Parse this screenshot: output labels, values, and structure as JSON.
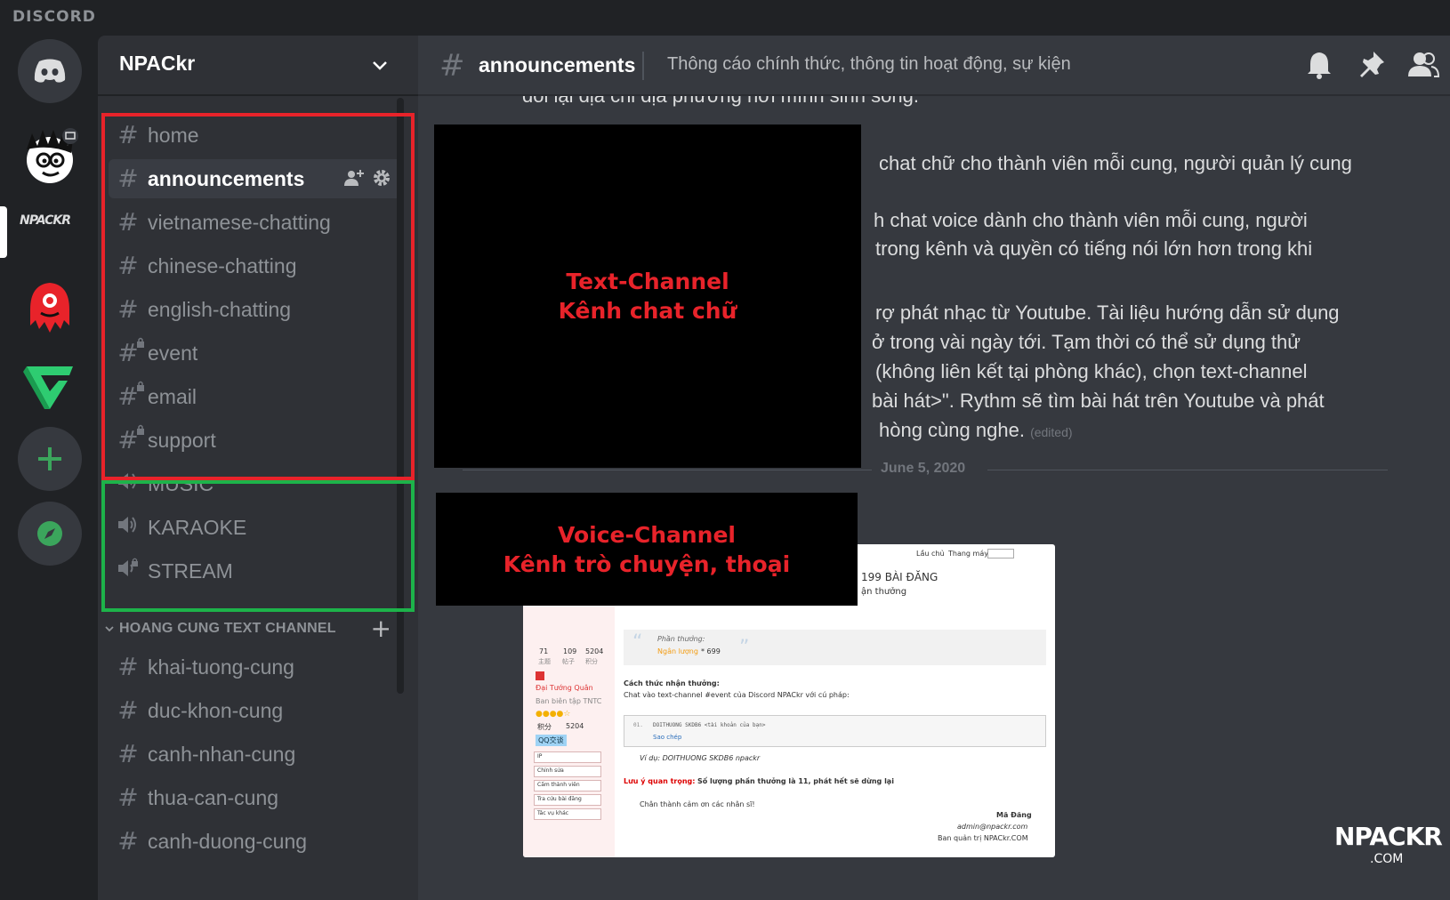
{
  "app": {
    "wordmark": "DISCORD"
  },
  "guilds": {
    "items": [
      {
        "name": "home-icon"
      },
      {
        "name": "npackr-avatar"
      },
      {
        "name": "NPACKR"
      },
      {
        "name": "red-mascot"
      },
      {
        "name": "green-v-logo"
      },
      {
        "name": "add-server"
      },
      {
        "name": "explore"
      }
    ],
    "npackr_label": "NPACKR"
  },
  "server": {
    "name": "NPACkr"
  },
  "channels": {
    "text": [
      {
        "label": "home",
        "locked": false
      },
      {
        "label": "announcements",
        "locked": false,
        "active": true
      },
      {
        "label": "vietnamese-chatting",
        "locked": false
      },
      {
        "label": "chinese-chatting",
        "locked": false
      },
      {
        "label": "english-chatting",
        "locked": false
      },
      {
        "label": "event",
        "locked": true
      },
      {
        "label": "email",
        "locked": true
      },
      {
        "label": "support",
        "locked": true
      }
    ],
    "voice": [
      {
        "label": "MUSIC",
        "locked": false
      },
      {
        "label": "KARAOKE",
        "locked": false
      },
      {
        "label": "STREAM",
        "locked": true
      }
    ],
    "category": {
      "label": "HOANG CUNG TEXT CHANNEL",
      "items": [
        {
          "label": "khai-tuong-cung"
        },
        {
          "label": "duc-khon-cung"
        },
        {
          "label": "canh-nhan-cung"
        },
        {
          "label": "thua-can-cung"
        },
        {
          "label": "canh-duong-cung"
        }
      ]
    }
  },
  "chat": {
    "channel_name": "announcements",
    "topic": "Thông cáo chính thức, thông tin hoạt động, sự kiện",
    "lines": [
      "đổi lại địa chỉ địa phương nơi mình sinh sống.",
      "chat chữ cho thành viên mỗi cung, người quản lý cung",
      "h chat voice dành cho thành viên mỗi cung, người",
      "trong kênh và quyền có tiếng nói lớn hơn trong khi",
      "rợ phát nhạc từ Youtube. Tài liệu hướng dẫn sử dụng",
      "ở trong vài ngày tới. Tạm thời có thể sử dụng thử",
      "(không liên kết tại phòng khác), chọn text-channel",
      "bài hát>\". Rythm sẽ tìm bài hát trên Youtube và phát",
      "hòng cùng nghe."
    ],
    "edited": "(edited)",
    "date_divider": "June 5, 2020"
  },
  "annotations": {
    "text_channel": {
      "line1": "Text-Channel",
      "line2": "Kênh chat chữ"
    },
    "voice_channel": {
      "line1": "Voice-Channel",
      "line2": "Kênh trò chuyện, thoại"
    }
  },
  "embed": {
    "top_links": {
      "a": "Lầu chủ",
      "b": "Thang máy"
    },
    "post_count": "199 BÀI ĐĂNG",
    "reward_tag": "ận thưởng",
    "reward_label": "Phần thưởng:",
    "reward_value": "Ngân lượng",
    "reward_amount": "* 699",
    "stats": {
      "a": "71",
      "b": "109",
      "c": "5204",
      "a_l": "主题",
      "b_l": "帖子",
      "c_l": "积分"
    },
    "rank": "Đại Tướng Quân",
    "group": "Ban biên tập TNTC",
    "points_label": "积分",
    "points": "5204",
    "qq": "QQ交谈",
    "side_fields": [
      "IP",
      "Chỉnh sửa",
      "Cấm thành viên",
      "Tra cứu bài đăng",
      "Tác vụ khác"
    ],
    "howto_title": "Cách thức nhận thưởng:",
    "howto_text": "Chat vào text-channel #event của Discord NPACkr với cú pháp:",
    "code_no": "01.",
    "code_text": "DOITHUONG SKDB6 <tài khoản của bạn>",
    "copy": "Sao chép",
    "example": "Ví dụ: DOITHUONG SKDB6 npackr",
    "note_label": "Lưu ý quan trọng:",
    "note_text": "Số lượng phần thưởng là 11, phát hết sẽ dừng lại",
    "thanks": "Chân thành cảm ơn các nhân sĩ!",
    "sign_name": "Mã Đăng",
    "sign_email": "admin@npackr.com",
    "sign_role": "Ban quản trị NPACkr.COM"
  },
  "watermark": {
    "main": "NPACKR",
    "sub": ".COM"
  },
  "colors": {
    "annotation_red": "#e8232a",
    "annotation_green": "#1db34a",
    "bg": "#36393f"
  }
}
